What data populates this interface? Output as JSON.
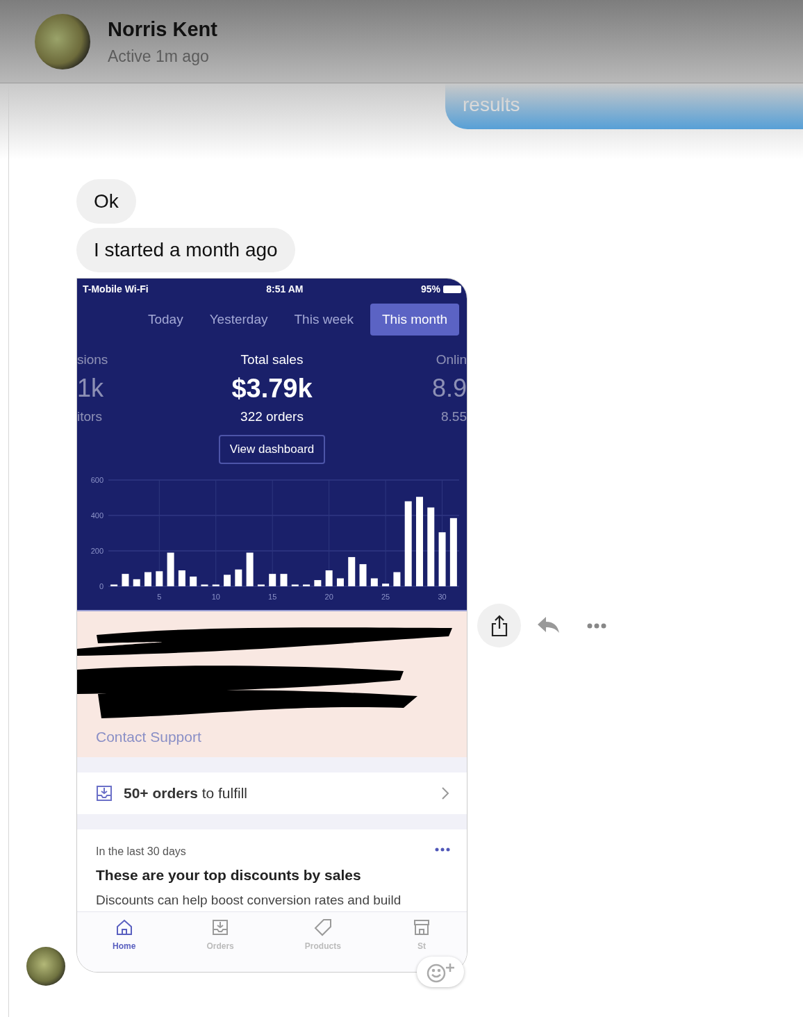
{
  "header": {
    "name": "Norris Kent",
    "status": "Active 1m ago"
  },
  "messages": [
    {
      "kind": "outgoing",
      "text": "results"
    },
    {
      "kind": "incoming",
      "text": "Ok"
    },
    {
      "kind": "incoming",
      "text": "I started a month ago"
    }
  ],
  "shared_screenshot": {
    "status_bar": {
      "carrier": "T-Mobile Wi-Fi",
      "time": "8:51 AM",
      "battery": "95%"
    },
    "tabs": [
      {
        "label": "Today",
        "selected": false
      },
      {
        "label": "Yesterday",
        "selected": false
      },
      {
        "label": "This week",
        "selected": false
      },
      {
        "label": "This month",
        "selected": true
      }
    ],
    "metrics": [
      {
        "label": "sions",
        "value": "1k",
        "sub": "itors"
      },
      {
        "label": "Total sales",
        "value": "$3.79k",
        "sub": "322 orders"
      },
      {
        "label": "Onlin",
        "value": "8.9",
        "sub": "8.55"
      }
    ],
    "dashboard_button": "View dashboard",
    "chart_data": {
      "type": "bar",
      "grid": true,
      "x": [
        1,
        2,
        3,
        4,
        5,
        6,
        7,
        8,
        9,
        10,
        11,
        12,
        13,
        14,
        15,
        16,
        17,
        18,
        19,
        20,
        21,
        22,
        23,
        24,
        25,
        26,
        27,
        28,
        29,
        30,
        31
      ],
      "series": [
        {
          "color": "#ffffff",
          "values": [
            10,
            70,
            40,
            80,
            85,
            190,
            90,
            55,
            10,
            10,
            65,
            95,
            190,
            10,
            70,
            70,
            10,
            10,
            35,
            90,
            45,
            165,
            125,
            45,
            15,
            80,
            480,
            505,
            445,
            305,
            385
          ]
        }
      ],
      "xlim": [
        0.5,
        31.5
      ],
      "ylim": [
        0,
        600
      ],
      "yticks": [
        0,
        200,
        400,
        600
      ],
      "xticks": [
        5,
        10,
        15,
        20,
        25,
        30
      ]
    },
    "notice": {
      "link": "Contact Support"
    },
    "fulfill_row": {
      "text": "**50+ orders** to fulfill"
    },
    "discount_card": {
      "eyebrow": "In the last 30 days",
      "title": "These are your top discounts by sales",
      "body": "Discounts can help boost conversion rates and build"
    },
    "nav": [
      {
        "label": "Home",
        "selected": true
      },
      {
        "label": "Orders",
        "selected": false
      },
      {
        "label": "Products",
        "selected": false
      },
      {
        "label": "St",
        "selected": false
      }
    ]
  }
}
